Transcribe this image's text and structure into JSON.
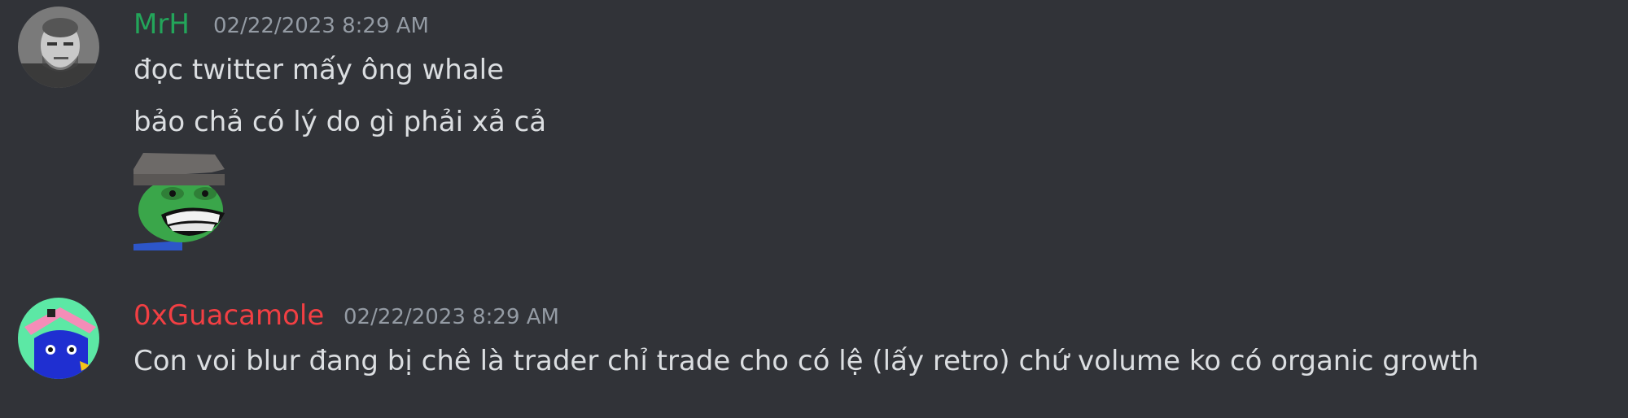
{
  "messages": [
    {
      "author": "MrH",
      "author_color": "#23a55a",
      "timestamp": "02/22/2023 8:29 AM",
      "avatar_icon": "bald-man-avatar",
      "lines": [
        "đọc twitter mấy ông whale",
        "bảo chả có lý do gì phải xả cả"
      ],
      "sticker": "smiling-frog-sticker"
    },
    {
      "author": "0xGuacamole",
      "author_color": "#f23f43",
      "timestamp": "02/22/2023 8:29 AM",
      "avatar_icon": "blue-creature-avatar",
      "lines": [
        "Con voi blur đang bị chê là trader chỉ trade cho có lệ (lấy retro) chứ volume ko có organic growth"
      ]
    }
  ]
}
